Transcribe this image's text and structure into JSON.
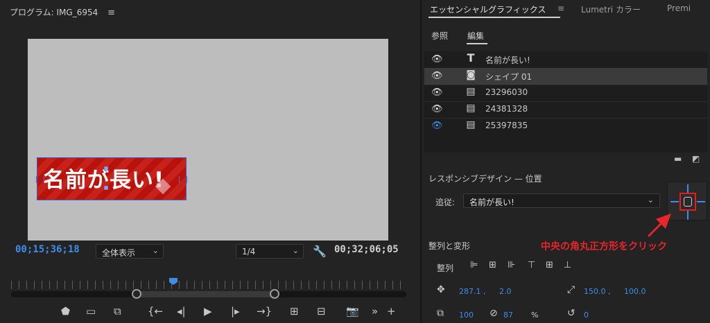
{
  "program": {
    "title": "プログラム: IMG_6954",
    "menu_icon": "≡",
    "overlay_title": "名前が長い!",
    "timecode_current": "00;15;36;18",
    "fit_select": "全体表示",
    "resolution_select": "1/4",
    "timecode_duration": "00;32;06;05"
  },
  "essential": {
    "tabs": [
      "エッセンシャルグラフィックス",
      "Lumetri カラー",
      "Premi"
    ],
    "tab_menu_icon": "≡",
    "subtabs": [
      "参照",
      "編集"
    ],
    "layers": [
      {
        "name": "名前が長い!",
        "icon": "text-icon",
        "visible": true,
        "selected": false
      },
      {
        "name": "シェイプ 01",
        "icon": "shape-icon",
        "visible": true,
        "selected": true
      },
      {
        "name": "23296030",
        "icon": "clip-icon",
        "visible": true,
        "selected": false
      },
      {
        "name": "24381328",
        "icon": "clip-icon",
        "visible": true,
        "selected": false
      },
      {
        "name": "25397835",
        "icon": "clip-icon",
        "visible": false,
        "selected": false
      }
    ],
    "responsive_heading": "レスポンシブデザイン — 位置",
    "follow_label": "追従:",
    "follow_value": "名前が長い!",
    "transform_heading": "整列と変形",
    "align_label": "整列",
    "position_x": "287.1 ,",
    "position_y": "2.0",
    "anchor_x": "150.0 ,",
    "anchor_y": "100.0",
    "scale": "100",
    "opacity": "87",
    "opacity_unit": "%",
    "rotation": "0",
    "annotation": "中央の角丸正方形をクリック"
  },
  "colors": {
    "accent_blue": "#3d8ee8",
    "annotation_red": "#e8252b",
    "title_bg": "#c01a14"
  }
}
